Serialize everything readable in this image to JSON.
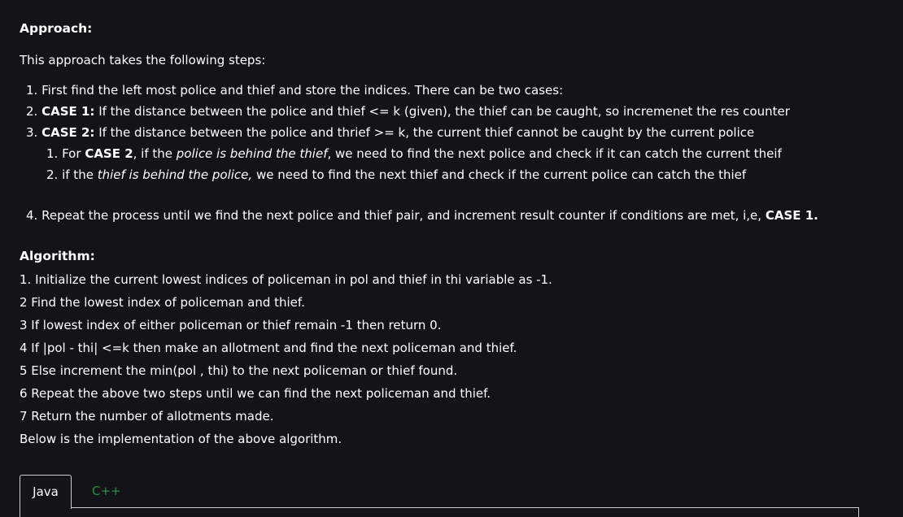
{
  "approach": {
    "heading": "Approach:",
    "intro": "This approach takes the following steps:",
    "steps": [
      {
        "num": "1.",
        "bold": "",
        "text": "First find the left most police and thief and store the indices. There can be two cases:"
      },
      {
        "num": "2.",
        "bold": "CASE 1:",
        "text": " If the distance between the police and thief <= k (given), the thief can be caught, so incremenet the res counter"
      },
      {
        "num": "3.",
        "bold": "CASE 2:",
        "text": " If the distance between the police and thrief >= k, the current thief cannot be caught by the current police"
      }
    ],
    "substeps": [
      {
        "num": "1.",
        "pre": "For ",
        "bold": "CASE 2",
        "mid": ", if the ",
        "italic": "police is behind the thief",
        "post": ", we need to find the next police and check if it can catch the current theif"
      },
      {
        "num": "2.",
        "pre": "if the ",
        "bold": "",
        "mid": "",
        "italic": "thief is behind the police,",
        "post": " we need to find the next thief and check if the current police can catch the thief"
      }
    ],
    "step4": {
      "num": "4.",
      "text": "Repeat the process until we find the next police and thief pair, and increment result counter if conditions are met, i,e, ",
      "bold": "CASE 1."
    }
  },
  "algorithm": {
    "heading": "Algorithm:",
    "lines": [
      "1. Initialize the current lowest indices of policeman in pol and thief in thi variable as -1.",
      "2 Find the lowest index of policeman and thief.",
      "3 If lowest index of either policeman or thief remain -1 then return 0.",
      "4 If |pol - thi| <=k then make an allotment and find the next policeman and thief.",
      "5 Else increment the min(pol , thi) to the next policeman or thief found.",
      "6 Repeat the above two steps until we can find the next policeman and thief.",
      "7 Return the number of allotments made.",
      "Below is the implementation of the above algorithm."
    ]
  },
  "tabs": [
    {
      "label": "Java",
      "active": true
    },
    {
      "label": "C++",
      "active": false
    }
  ],
  "colors": {
    "background": "#131417",
    "text": "#ffffff",
    "tab_inactive": "#2f8d46",
    "border": "#cfcfcf"
  }
}
